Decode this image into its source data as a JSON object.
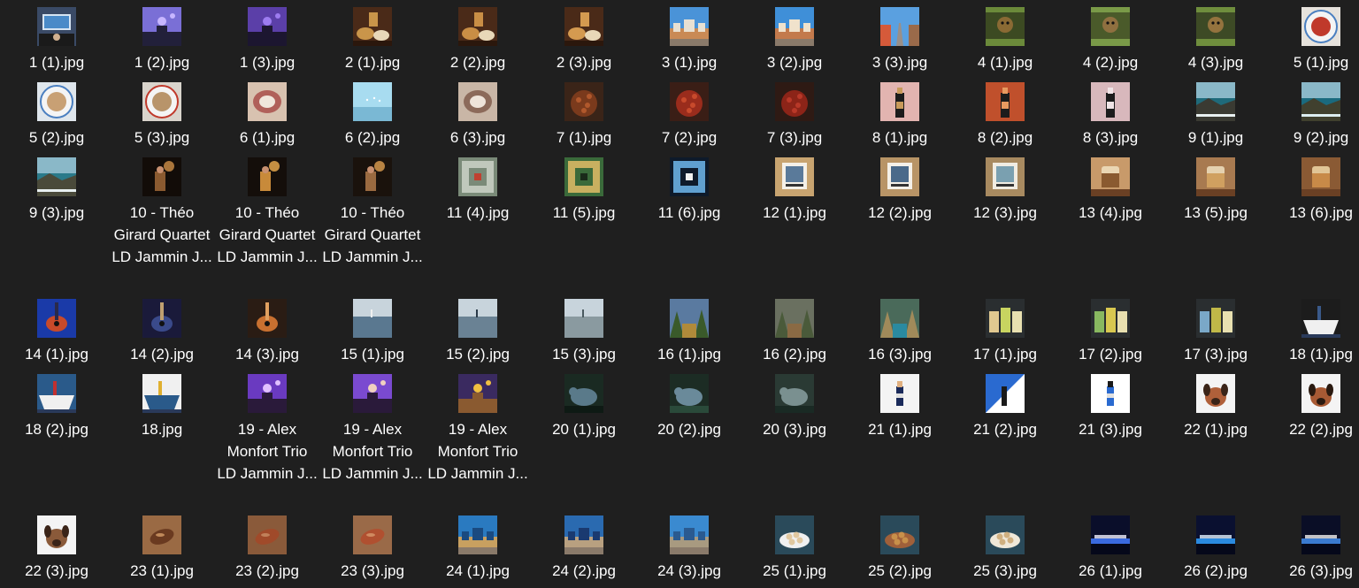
{
  "explorer": {
    "rows": [
      {
        "items": [
          {
            "name": "1 (1).jpg",
            "thumb": {
              "bg": "#3a4a66",
              "fg": "#d6e4f2",
              "accent": "#1a1a1a",
              "kind": "desk"
            }
          },
          {
            "name": "1 (2).jpg",
            "thumb": {
              "bg": "#7a6fd6",
              "fg": "#22203a",
              "accent": "#c7b6ff",
              "kind": "stage"
            }
          },
          {
            "name": "1 (3).jpg",
            "thumb": {
              "bg": "#5b3fa8",
              "fg": "#1c1630",
              "accent": "#9d7cf0",
              "kind": "stage"
            }
          },
          {
            "name": "2 (1).jpg",
            "thumb": {
              "bg": "#4a2a18",
              "fg": "#c9954a",
              "accent": "#2b170c",
              "kind": "bowls"
            }
          },
          {
            "name": "2 (2).jpg",
            "thumb": {
              "bg": "#4a2a18",
              "fg": "#c98e45",
              "accent": "#2b170c",
              "kind": "bowls"
            }
          },
          {
            "name": "2 (3).jpg",
            "thumb": {
              "bg": "#4a2a18",
              "fg": "#d49a50",
              "accent": "#2b170c",
              "kind": "bowls"
            }
          },
          {
            "name": "3 (1).jpg",
            "thumb": {
              "bg": "#4a93d8",
              "fg": "#c98a55",
              "accent": "#e8e0d2",
              "kind": "city"
            }
          },
          {
            "name": "3 (2).jpg",
            "thumb": {
              "bg": "#3f8fd8",
              "fg": "#c37a4c",
              "accent": "#f0e2cc",
              "kind": "city"
            }
          },
          {
            "name": "3 (3).jpg",
            "thumb": {
              "bg": "#5aa0e0",
              "fg": "#9a8f88",
              "accent": "#d55a3a",
              "kind": "street"
            }
          },
          {
            "name": "4 (1).jpg",
            "thumb": {
              "bg": "#3c4a22",
              "fg": "#8a6a34",
              "accent": "#6b8a3a",
              "kind": "animal"
            }
          },
          {
            "name": "4 (2).jpg",
            "thumb": {
              "bg": "#4a5a2a",
              "fg": "#8f7040",
              "accent": "#7a9a48",
              "kind": "animal"
            }
          },
          {
            "name": "4 (3).jpg",
            "thumb": {
              "bg": "#3d4a25",
              "fg": "#94733e",
              "accent": "#6f8e3d",
              "kind": "animal"
            }
          },
          {
            "name": "5 (1).jpg",
            "thumb": {
              "bg": "#e6e2dc",
              "fg": "#c0392b",
              "accent": "#4a7fc0",
              "kind": "plate"
            }
          }
        ]
      },
      {
        "items": [
          {
            "name": "5 (2).jpg",
            "thumb": {
              "bg": "#dfe6ec",
              "fg": "#c8a074",
              "accent": "#4a7fc0",
              "kind": "plate"
            }
          },
          {
            "name": "5 (3).jpg",
            "thumb": {
              "bg": "#d9d4cc",
              "fg": "#b8946a",
              "accent": "#c0392b",
              "kind": "plate"
            }
          },
          {
            "name": "6 (1).jpg",
            "thumb": {
              "bg": "#d8c2b0",
              "fg": "#b0605a",
              "accent": "#f0e6dc",
              "kind": "shell"
            }
          },
          {
            "name": "6 (2).jpg",
            "thumb": {
              "bg": "#a8dcf0",
              "fg": "#7ab8d4",
              "accent": "#ffffff",
              "kind": "sky"
            }
          },
          {
            "name": "6 (3).jpg",
            "thumb": {
              "bg": "#c9b6a6",
              "fg": "#8c6a5a",
              "accent": "#efe4da",
              "kind": "shell"
            }
          },
          {
            "name": "7 (1).jpg",
            "thumb": {
              "bg": "#3a2418",
              "fg": "#7a3a1c",
              "accent": "#b0582c",
              "kind": "beans"
            }
          },
          {
            "name": "7 (2).jpg",
            "thumb": {
              "bg": "#3a1e16",
              "fg": "#9a2c1c",
              "accent": "#c84a2c",
              "kind": "beans"
            }
          },
          {
            "name": "7 (3).jpg",
            "thumb": {
              "bg": "#2e1a14",
              "fg": "#8c2418",
              "accent": "#b83828",
              "kind": "beans"
            }
          },
          {
            "name": "8 (1).jpg",
            "thumb": {
              "bg": "#e2b4b0",
              "fg": "#1c1c1c",
              "accent": "#c89a5a",
              "kind": "bottle"
            }
          },
          {
            "name": "8 (2).jpg",
            "thumb": {
              "bg": "#c0502c",
              "fg": "#1c1c1c",
              "accent": "#e89a60",
              "kind": "bottle"
            }
          },
          {
            "name": "8 (3).jpg",
            "thumb": {
              "bg": "#d8b8bc",
              "fg": "#1c1c1c",
              "accent": "#f0e4e6",
              "kind": "bottle"
            }
          },
          {
            "name": "9 (1).jpg",
            "thumb": {
              "bg": "#1f6a7a",
              "fg": "#3a3a32",
              "accent": "#e8f0f0",
              "kind": "coast"
            }
          },
          {
            "name": "9 (2).jpg",
            "thumb": {
              "bg": "#1a6a7e",
              "fg": "#40402e",
              "accent": "#ddeef0",
              "kind": "coast"
            }
          }
        ]
      },
      {
        "items": [
          {
            "name": "9 (3).jpg",
            "thumb": {
              "bg": "#2a7a8a",
              "fg": "#4a4a3a",
              "accent": "#e8f0f0",
              "kind": "coast"
            }
          },
          {
            "name": "10 - Théo Girard Quartet LD Jammin J...",
            "thumb": {
              "bg": "#120c08",
              "fg": "#8a5a30",
              "accent": "#d09048",
              "kind": "dark"
            }
          },
          {
            "name": "10 - Théo Girard Quartet LD Jammin J...",
            "thumb": {
              "bg": "#140e0a",
              "fg": "#c88a3a",
              "accent": "#f0b050",
              "kind": "dark"
            }
          },
          {
            "name": "10 - Théo Girard Quartet LD Jammin J...",
            "thumb": {
              "bg": "#1a120c",
              "fg": "#9a6a40",
              "accent": "#e0a050",
              "kind": "dark"
            }
          },
          {
            "name": "11 (4).jpg",
            "thumb": {
              "bg": "#7a8a78",
              "fg": "#c0c8bc",
              "accent": "#c04030",
              "kind": "tunnel"
            }
          },
          {
            "name": "11 (5).jpg",
            "thumb": {
              "bg": "#3a6a3a",
              "fg": "#c8b060",
              "accent": "#1a2a1a",
              "kind": "tunnel"
            }
          },
          {
            "name": "11 (6).jpg",
            "thumb": {
              "bg": "#0e1a2a",
              "fg": "#60a0d0",
              "accent": "#f0f0f0",
              "kind": "tunnel"
            }
          },
          {
            "name": "12 (1).jpg",
            "thumb": {
              "bg": "#c8a470",
              "fg": "#f4f0e8",
              "accent": "#5a7a9a",
              "kind": "frame"
            }
          },
          {
            "name": "12 (2).jpg",
            "thumb": {
              "bg": "#b89466",
              "fg": "#f4f0e8",
              "accent": "#4a6a8a",
              "kind": "frame"
            }
          },
          {
            "name": "12 (3).jpg",
            "thumb": {
              "bg": "#a88a60",
              "fg": "#f0ece2",
              "accent": "#7aa0b0",
              "kind": "frame"
            }
          },
          {
            "name": "13 (4).jpg",
            "thumb": {
              "bg": "#c89a6a",
              "fg": "#8a5a30",
              "accent": "#f0e0c0",
              "kind": "jar"
            }
          },
          {
            "name": "13 (5).jpg",
            "thumb": {
              "bg": "#a87a50",
              "fg": "#d0a060",
              "accent": "#f0e0c0",
              "kind": "jar"
            }
          },
          {
            "name": "13 (6).jpg",
            "thumb": {
              "bg": "#8a5a34",
              "fg": "#c88a48",
              "accent": "#f0d8a8",
              "kind": "jar"
            }
          }
        ]
      },
      {
        "items": [
          {
            "name": "14 (1).jpg",
            "thumb": {
              "bg": "#1a3aa8",
              "fg": "#c84a2a",
              "accent": "#2a2a4a",
              "kind": "guitar"
            }
          },
          {
            "name": "14 (2).jpg",
            "thumb": {
              "bg": "#1a1a3a",
              "fg": "#3a4a8a",
              "accent": "#c0a070",
              "kind": "guitar"
            }
          },
          {
            "name": "14 (3).jpg",
            "thumb": {
              "bg": "#2a1c14",
              "fg": "#c87030",
              "accent": "#e0a060",
              "kind": "guitar"
            }
          },
          {
            "name": "15 (1).jpg",
            "thumb": {
              "bg": "#9ab0c4",
              "fg": "#5a7890",
              "accent": "#f0f0f0",
              "kind": "sea"
            }
          },
          {
            "name": "15 (2).jpg",
            "thumb": {
              "bg": "#b0c0cc",
              "fg": "#6a8294",
              "accent": "#2a3a48",
              "kind": "sea"
            }
          },
          {
            "name": "15 (3).jpg",
            "thumb": {
              "bg": "#c8d0d4",
              "fg": "#8a9aa0",
              "accent": "#4a5a60",
              "kind": "sea"
            }
          },
          {
            "name": "16 (1).jpg",
            "thumb": {
              "bg": "#5a7aa0",
              "fg": "#b08a3a",
              "accent": "#3a5a2a",
              "kind": "forest"
            }
          },
          {
            "name": "16 (2).jpg",
            "thumb": {
              "bg": "#6a7060",
              "fg": "#8a6a44",
              "accent": "#4a5a3a",
              "kind": "forest"
            }
          },
          {
            "name": "16 (3).jpg",
            "thumb": {
              "bg": "#4a6a5a",
              "fg": "#2a8aa0",
              "accent": "#a08a5a",
              "kind": "forest"
            }
          },
          {
            "name": "17 (1).jpg",
            "thumb": {
              "bg": "#2a2e30",
              "fg": "#c8d460",
              "accent": "#e0c890",
              "kind": "soap"
            }
          },
          {
            "name": "17 (2).jpg",
            "thumb": {
              "bg": "#2a2e30",
              "fg": "#d8c850",
              "accent": "#88b860",
              "kind": "soap"
            }
          },
          {
            "name": "17 (3).jpg",
            "thumb": {
              "bg": "#2a2e30",
              "fg": "#c0b848",
              "accent": "#7aa8c8",
              "kind": "soap"
            }
          },
          {
            "name": "18 (1).jpg",
            "thumb": {
              "bg": "#1c1c1c",
              "fg": "#f0f0f0",
              "accent": "#3a5a8a",
              "kind": "boat"
            }
          }
        ]
      },
      {
        "items": [
          {
            "name": "18 (2).jpg",
            "thumb": {
              "bg": "#2a5a8a",
              "fg": "#f0f0f0",
              "accent": "#c03030",
              "kind": "boat"
            }
          },
          {
            "name": "18.jpg",
            "thumb": {
              "bg": "#f0f0f0",
              "fg": "#2a5a8a",
              "accent": "#e0b030",
              "kind": "boat"
            }
          },
          {
            "name": "19 - Alex Monfort Trio LD Jammin J...",
            "thumb": {
              "bg": "#6a3ac0",
              "fg": "#2a1a3a",
              "accent": "#e0c0ff",
              "kind": "stage"
            }
          },
          {
            "name": "19 - Alex Monfort Trio LD Jammin J...",
            "thumb": {
              "bg": "#7a4ad0",
              "fg": "#2a1a3a",
              "accent": "#f0d0c0",
              "kind": "stage"
            }
          },
          {
            "name": "19 - Alex Monfort Trio LD Jammin J...",
            "thumb": {
              "bg": "#3a2a60",
              "fg": "#8a5a30",
              "accent": "#f0c040",
              "kind": "stage"
            }
          },
          {
            "name": "20 (1).jpg",
            "thumb": {
              "bg": "#1a2a22",
              "fg": "#5a7a8a",
              "accent": "#0e1a14",
              "kind": "turtle"
            }
          },
          {
            "name": "20 (2).jpg",
            "thumb": {
              "bg": "#1c2c24",
              "fg": "#6a8a9a",
              "accent": "#2a4a3a",
              "kind": "turtle"
            }
          },
          {
            "name": "20 (3).jpg",
            "thumb": {
              "bg": "#2a3a34",
              "fg": "#7a9090",
              "accent": "#1a2a24",
              "kind": "turtle"
            }
          },
          {
            "name": "21 (1).jpg",
            "thumb": {
              "bg": "#f4f4f4",
              "fg": "#1a2a5a",
              "accent": "#e0b080",
              "kind": "product"
            }
          },
          {
            "name": "21 (2).jpg",
            "thumb": {
              "bg": "#2a6ad0",
              "fg": "#ffffff",
              "accent": "#1a1a1a",
              "kind": "split"
            }
          },
          {
            "name": "21 (3).jpg",
            "thumb": {
              "bg": "#ffffff",
              "fg": "#2a6ad0",
              "accent": "#1a1a1a",
              "kind": "product"
            }
          },
          {
            "name": "22 (1).jpg",
            "thumb": {
              "bg": "#f4f4f4",
              "fg": "#b0603a",
              "accent": "#3a2418",
              "kind": "dog"
            }
          },
          {
            "name": "22 (2).jpg",
            "thumb": {
              "bg": "#f4f4f4",
              "fg": "#a85a34",
              "accent": "#2a1a10",
              "kind": "dog"
            }
          }
        ]
      },
      {
        "items": [
          {
            "name": "22 (3).jpg",
            "thumb": {
              "bg": "#f4f4f4",
              "fg": "#8a5a3a",
              "accent": "#3a2418",
              "kind": "dog"
            }
          },
          {
            "name": "23 (1).jpg",
            "thumb": {
              "bg": "#9a6a44",
              "fg": "#6a3a20",
              "accent": "#c08a5a",
              "kind": "potato"
            }
          },
          {
            "name": "23 (2).jpg",
            "thumb": {
              "bg": "#8a5a3a",
              "fg": "#a04a2a",
              "accent": "#c0805a",
              "kind": "potato"
            }
          },
          {
            "name": "23 (3).jpg",
            "thumb": {
              "bg": "#9a6a48",
              "fg": "#b05030",
              "accent": "#d08a60",
              "kind": "potato"
            }
          },
          {
            "name": "24 (1).jpg",
            "thumb": {
              "bg": "#2a7ac0",
              "fg": "#c8a060",
              "accent": "#1a4a80",
              "kind": "city"
            }
          },
          {
            "name": "24 (2).jpg",
            "thumb": {
              "bg": "#2a6ab0",
              "fg": "#b8a080",
              "accent": "#1a3a70",
              "kind": "city"
            }
          },
          {
            "name": "24 (3).jpg",
            "thumb": {
              "bg": "#3a8ad0",
              "fg": "#a89a80",
              "accent": "#2a5a90",
              "kind": "city"
            }
          },
          {
            "name": "25 (1).jpg",
            "thumb": {
              "bg": "#2a4a5a",
              "fg": "#e0c8a0",
              "accent": "#f0f0f0",
              "kind": "nuts"
            }
          },
          {
            "name": "25 (2).jpg",
            "thumb": {
              "bg": "#2a4a5a",
              "fg": "#c8904a",
              "accent": "#a0603a",
              "kind": "nuts"
            }
          },
          {
            "name": "25 (3).jpg",
            "thumb": {
              "bg": "#2a4a5a",
              "fg": "#d0b080",
              "accent": "#f0e8d8",
              "kind": "nuts"
            }
          },
          {
            "name": "26 (1).jpg",
            "thumb": {
              "bg": "#0a0e2a",
              "fg": "#3a6ae0",
              "accent": "#f0f0ff",
              "kind": "concert"
            }
          },
          {
            "name": "26 (2).jpg",
            "thumb": {
              "bg": "#0a1030",
              "fg": "#2a8ae0",
              "accent": "#e0f0ff",
              "kind": "concert"
            }
          },
          {
            "name": "26 (3).jpg",
            "thumb": {
              "bg": "#0a0e26",
              "fg": "#3a7ad0",
              "accent": "#f0f0f0",
              "kind": "concert"
            }
          }
        ]
      }
    ]
  }
}
